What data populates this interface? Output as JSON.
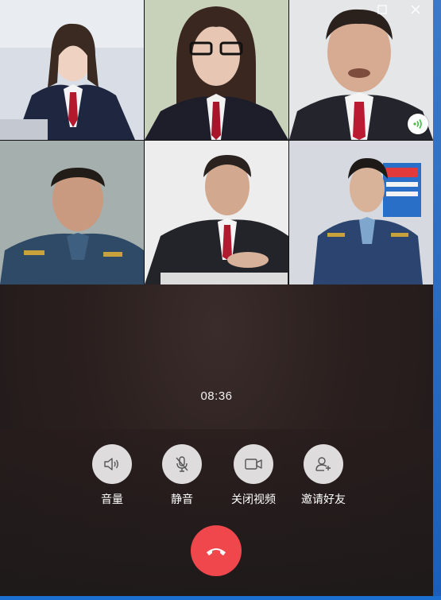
{
  "window": {
    "controls": {
      "maximize_icon": "maximize-icon",
      "close_icon": "close-icon"
    }
  },
  "participants": [
    {
      "position": "top-left",
      "speaking": false
    },
    {
      "position": "top-center",
      "speaking": false
    },
    {
      "position": "top-right",
      "speaking": true
    },
    {
      "position": "bottom-left",
      "speaking": false
    },
    {
      "position": "bottom-center",
      "speaking": false
    },
    {
      "position": "bottom-right",
      "speaking": false
    }
  ],
  "call": {
    "duration": "08:36"
  },
  "controls": [
    {
      "label": "音量",
      "icon": "speaker-icon"
    },
    {
      "label": "静音",
      "icon": "mic-off-icon"
    },
    {
      "label": "关闭视频",
      "icon": "video-camera-icon"
    },
    {
      "label": "邀请好友",
      "icon": "add-user-icon"
    }
  ],
  "hangup": {
    "icon": "hangup-icon"
  },
  "colors": {
    "hangup": "#f0474d",
    "control_circle": "#dedcdc",
    "speaking_indicator": "#3cc24b",
    "window_accent": "#1a6fd0"
  }
}
